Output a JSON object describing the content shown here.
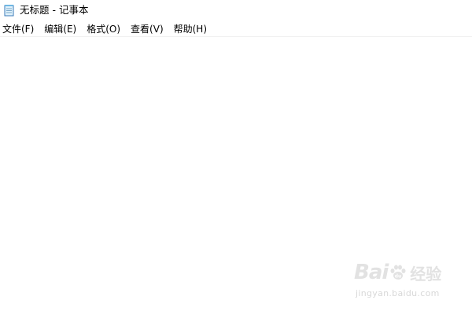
{
  "window": {
    "title": "无标题 - 记事本",
    "icon": "notepad-icon"
  },
  "menu": {
    "items": [
      {
        "label": "文件(F)"
      },
      {
        "label": "编辑(E)"
      },
      {
        "label": "格式(O)"
      },
      {
        "label": "查看(V)"
      },
      {
        "label": "帮助(H)"
      }
    ]
  },
  "editor": {
    "value": ""
  },
  "watermark": {
    "brand_prefix": "Bai",
    "brand_suffix": "经验",
    "url": "jingyan.baidu.com",
    "icon": "baidu-paw-icon",
    "color": "#e2e2e2"
  }
}
